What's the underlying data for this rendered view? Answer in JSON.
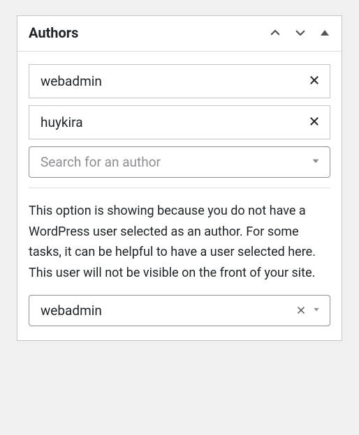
{
  "panel": {
    "title": "Authors"
  },
  "authors": [
    {
      "name": "webadmin"
    },
    {
      "name": "huykira"
    }
  ],
  "search": {
    "placeholder": "Search for an author"
  },
  "help_text": "This option is showing because you do not have a WordPress user selected as an author. For some tasks, it can be helpful to have a user selected here. This user will not be visible on the front of your site.",
  "fallback_select": {
    "value": "webadmin"
  }
}
